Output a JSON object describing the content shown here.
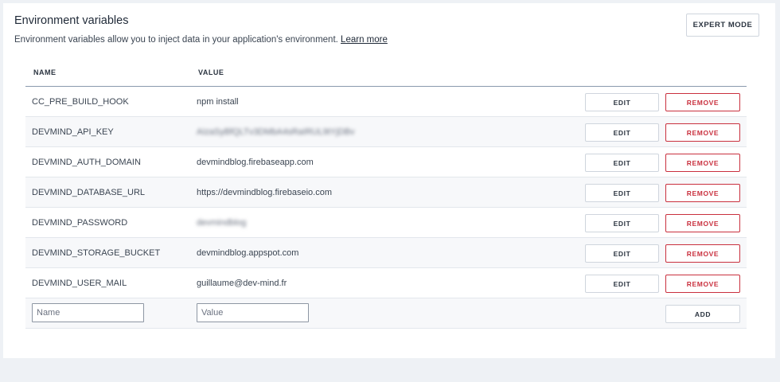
{
  "section": {
    "title": "Environment variables",
    "description": "Environment variables allow you to inject data in your application's environment.",
    "learn_more": "Learn more",
    "expert_mode": "EXPERT MODE"
  },
  "table": {
    "headers": {
      "name": "NAME",
      "value": "VALUE"
    },
    "rows": [
      {
        "name": "CC_PRE_BUILD_HOOK",
        "value": "npm install",
        "masked": false
      },
      {
        "name": "DEVMIND_API_KEY",
        "value": "AIzaSyBfQLTv3DMbA4sRaIRUL9tYjDBv",
        "masked": true
      },
      {
        "name": "DEVMIND_AUTH_DOMAIN",
        "value": "devmindblog.firebaseapp.com",
        "masked": false
      },
      {
        "name": "DEVMIND_DATABASE_URL",
        "value": "https://devmindblog.firebaseio.com",
        "masked": false
      },
      {
        "name": "DEVMIND_PASSWORD",
        "value": "devmindblog",
        "masked": true
      },
      {
        "name": "DEVMIND_STORAGE_BUCKET",
        "value": "devmindblog.appspot.com",
        "masked": false
      },
      {
        "name": "DEVMIND_USER_MAIL",
        "value": "guillaume@dev-mind.fr",
        "masked": false
      }
    ],
    "edit_label": "EDIT",
    "remove_label": "REMOVE",
    "new_row": {
      "name_placeholder": "Name",
      "value_placeholder": "Value",
      "add_label": "ADD"
    }
  },
  "colors": {
    "remove": "#c9303e",
    "border": "#cfd5dd",
    "background": "#eef1f5"
  }
}
